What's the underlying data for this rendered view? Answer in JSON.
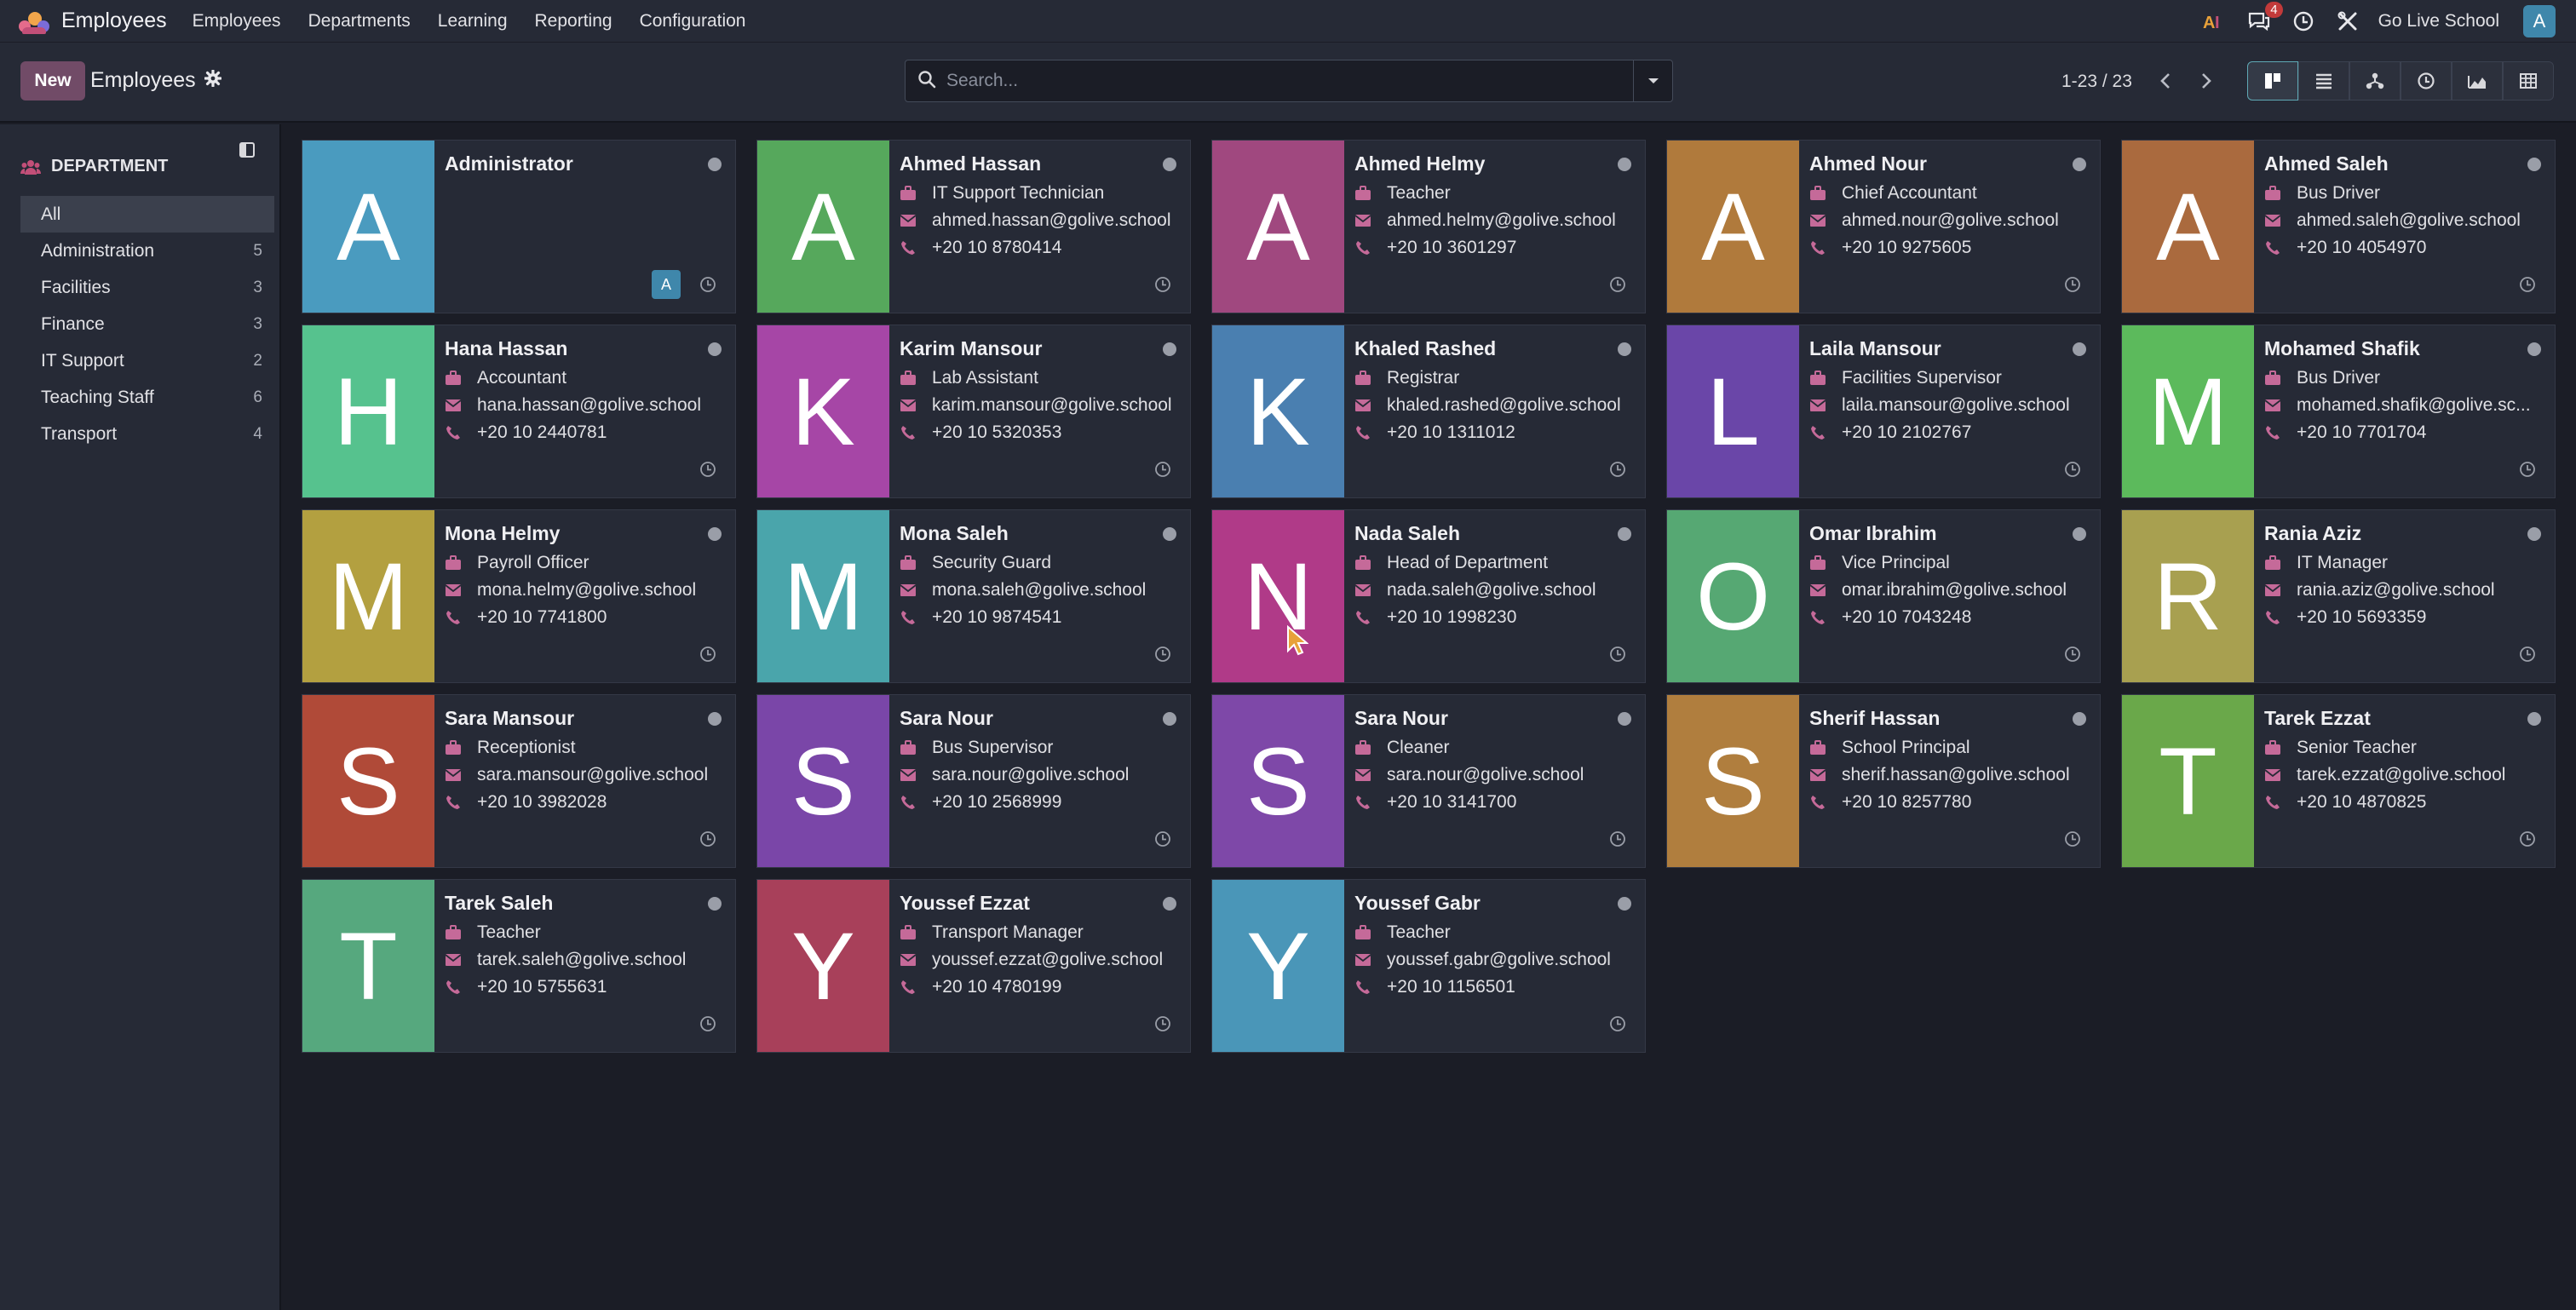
{
  "navbar": {
    "app_title": "Employees",
    "menu": [
      "Employees",
      "Departments",
      "Learning",
      "Reporting",
      "Configuration"
    ],
    "messages_badge": "4",
    "company": "Go Live School",
    "user_initial": "A"
  },
  "control": {
    "new_label": "New",
    "breadcrumb": "Employees",
    "search_placeholder": "Search...",
    "pager": "1-23 / 23"
  },
  "sidebar": {
    "heading": "DEPARTMENT",
    "items": [
      {
        "label": "All",
        "count": ""
      },
      {
        "label": "Administration",
        "count": "5"
      },
      {
        "label": "Facilities",
        "count": "3"
      },
      {
        "label": "Finance",
        "count": "3"
      },
      {
        "label": "IT Support",
        "count": "2"
      },
      {
        "label": "Teaching Staff",
        "count": "6"
      },
      {
        "label": "Transport",
        "count": "4"
      }
    ]
  },
  "employees": [
    {
      "initial": "A",
      "name": "Administrator",
      "job": "",
      "email": "",
      "phone": "",
      "color": "#4a9bbf",
      "avatar": "A"
    },
    {
      "initial": "A",
      "name": "Ahmed Hassan",
      "job": "IT Support Technician",
      "email": "ahmed.hassan@golive.school",
      "phone": "+20 10 8780414",
      "color": "#56a85c"
    },
    {
      "initial": "A",
      "name": "Ahmed Helmy",
      "job": "Teacher",
      "email": "ahmed.helmy@golive.school",
      "phone": "+20 10 3601297",
      "color": "#a0487f"
    },
    {
      "initial": "A",
      "name": "Ahmed Nour",
      "job": "Chief Accountant",
      "email": "ahmed.nour@golive.school",
      "phone": "+20 10 9275605",
      "color": "#b07a3c"
    },
    {
      "initial": "A",
      "name": "Ahmed Saleh",
      "job": "Bus Driver",
      "email": "ahmed.saleh@golive.school",
      "phone": "+20 10 4054970",
      "color": "#aa6a3e"
    },
    {
      "initial": "H",
      "name": "Hana Hassan",
      "job": "Accountant",
      "email": "hana.hassan@golive.school",
      "phone": "+20 10 2440781",
      "color": "#56c28e"
    },
    {
      "initial": "K",
      "name": "Karim Mansour",
      "job": "Lab Assistant",
      "email": "karim.mansour@golive.school",
      "phone": "+20 10 5320353",
      "color": "#a646a6"
    },
    {
      "initial": "K",
      "name": "Khaled Rashed",
      "job": "Registrar",
      "email": "khaled.rashed@golive.school",
      "phone": "+20 10 1311012",
      "color": "#4a7fb0"
    },
    {
      "initial": "L",
      "name": "Laila Mansour",
      "job": "Facilities Supervisor",
      "email": "laila.mansour@golive.school",
      "phone": "+20 10 2102767",
      "color": "#6a46a8"
    },
    {
      "initial": "M",
      "name": "Mohamed Shafik",
      "job": "Bus Driver",
      "email": "mohamed.shafik@golive.sc...",
      "phone": "+20 10 7701704",
      "color": "#5cba5c"
    },
    {
      "initial": "M",
      "name": "Mona Helmy",
      "job": "Payroll Officer",
      "email": "mona.helmy@golive.school",
      "phone": "+20 10 7741800",
      "color": "#b3a040"
    },
    {
      "initial": "M",
      "name": "Mona Saleh",
      "job": "Security Guard",
      "email": "mona.saleh@golive.school",
      "phone": "+20 10 9874541",
      "color": "#4aa5ab"
    },
    {
      "initial": "N",
      "name": "Nada Saleh",
      "job": "Head of Department",
      "email": "nada.saleh@golive.school",
      "phone": "+20 10 1998230",
      "color": "#b03a88"
    },
    {
      "initial": "O",
      "name": "Omar Ibrahim",
      "job": "Vice Principal",
      "email": "omar.ibrahim@golive.school",
      "phone": "+20 10 7043248",
      "color": "#56a873"
    },
    {
      "initial": "R",
      "name": "Rania Aziz",
      "job": "IT Manager",
      "email": "rania.aziz@golive.school",
      "phone": "+20 10 5693359",
      "color": "#a8a050"
    },
    {
      "initial": "S",
      "name": "Sara Mansour",
      "job": "Receptionist",
      "email": "sara.mansour@golive.school",
      "phone": "+20 10 3982028",
      "color": "#b04a38"
    },
    {
      "initial": "S",
      "name": "Sara Nour",
      "job": "Bus Supervisor",
      "email": "sara.nour@golive.school",
      "phone": "+20 10 2568999",
      "color": "#7a46a8"
    },
    {
      "initial": "S",
      "name": "Sara Nour",
      "job": "Cleaner",
      "email": "sara.nour@golive.school",
      "phone": "+20 10 3141700",
      "color": "#7e48a8"
    },
    {
      "initial": "S",
      "name": "Sherif Hassan",
      "job": "School Principal",
      "email": "sherif.hassan@golive.school",
      "phone": "+20 10 8257780",
      "color": "#b07e3e"
    },
    {
      "initial": "T",
      "name": "Tarek Ezzat",
      "job": "Senior Teacher",
      "email": "tarek.ezzat@golive.school",
      "phone": "+20 10 4870825",
      "color": "#6aa84a"
    },
    {
      "initial": "T",
      "name": "Tarek Saleh",
      "job": "Teacher",
      "email": "tarek.saleh@golive.school",
      "phone": "+20 10 5755631",
      "color": "#56a87e"
    },
    {
      "initial": "Y",
      "name": "Youssef Ezzat",
      "job": "Transport Manager",
      "email": "youssef.ezzat@golive.school",
      "phone": "+20 10 4780199",
      "color": "#a8405a"
    },
    {
      "initial": "Y",
      "name": "Youssef Gabr",
      "job": "Teacher",
      "email": "youssef.gabr@golive.school",
      "phone": "+20 10 1156501",
      "color": "#4a96b8"
    }
  ]
}
